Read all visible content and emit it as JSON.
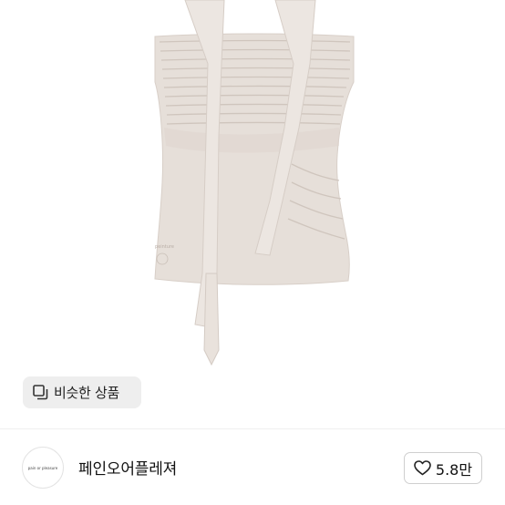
{
  "product": {
    "image_icon": "beige-ruched-halter-top-photo",
    "garment_color": "#e5ddd7",
    "logo_text": "peinture"
  },
  "similar_button": {
    "icon": "similar-items-icon",
    "label": "비슷한 상품"
  },
  "store": {
    "avatar_text": "pain or pleasure",
    "name": "페인오어플레져"
  },
  "like": {
    "icon": "heart-outline-icon",
    "count": "5.8만"
  }
}
